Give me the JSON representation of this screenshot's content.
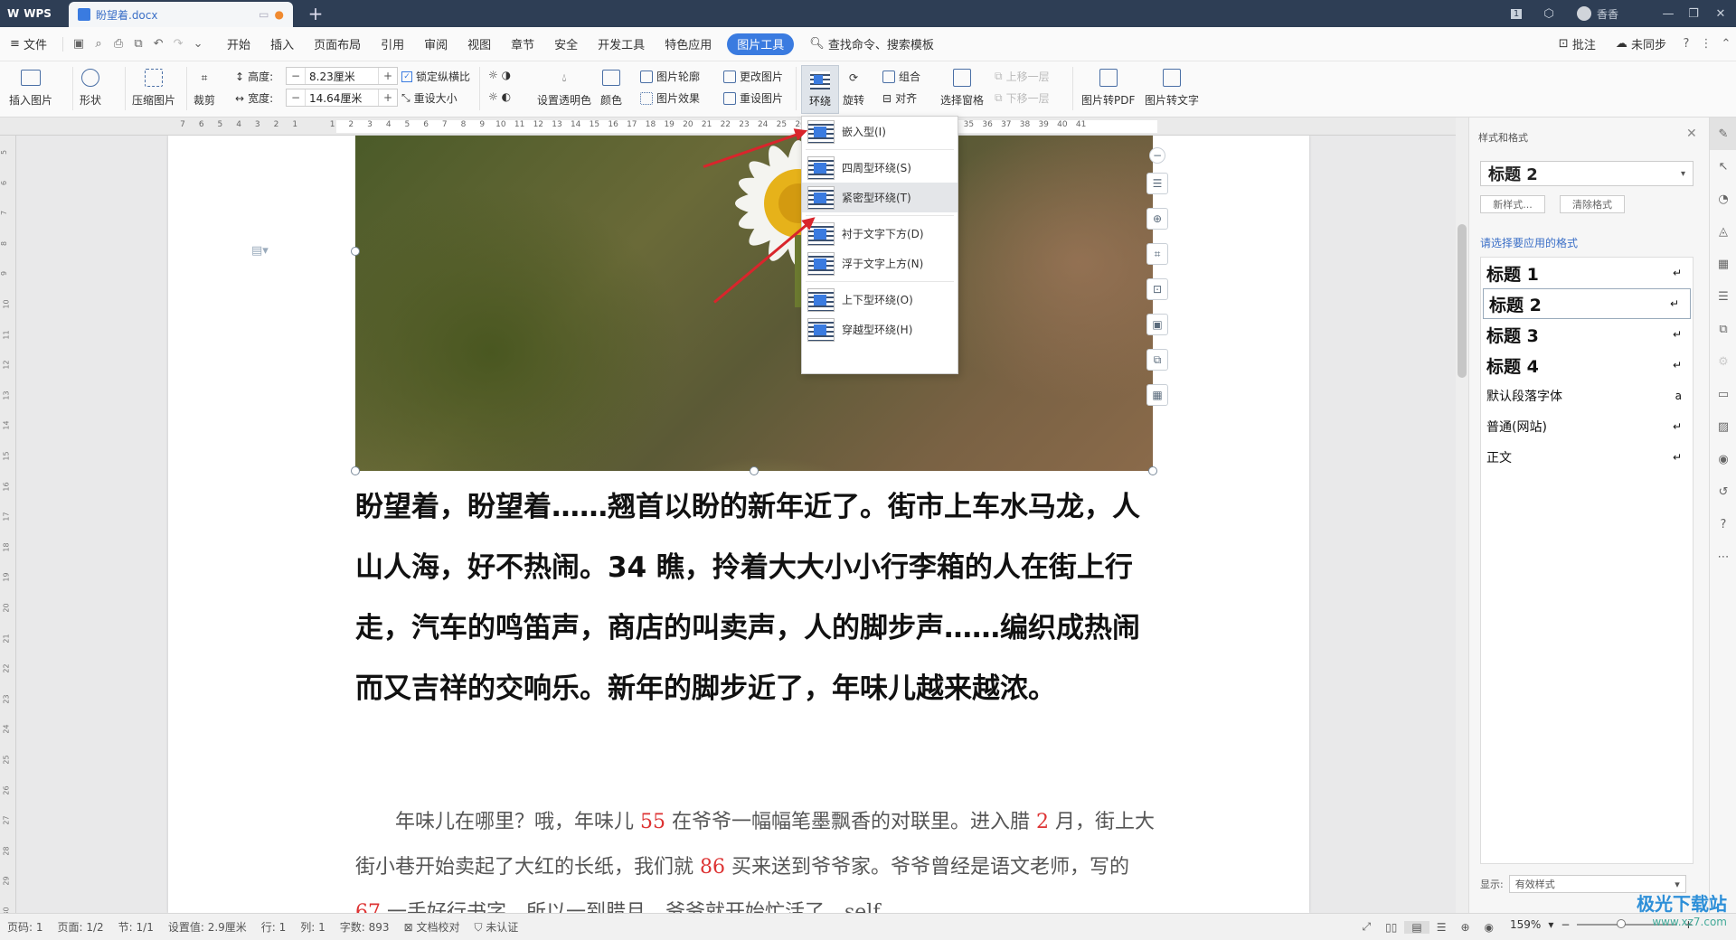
{
  "titlebar": {
    "app": "WPS",
    "doc_tab": "盼望着.docx",
    "page_badge": "1",
    "user": "香香"
  },
  "menu": {
    "file": "文件",
    "items": [
      "开始",
      "插入",
      "页面布局",
      "引用",
      "审阅",
      "视图",
      "章节",
      "安全",
      "开发工具",
      "特色应用"
    ],
    "active": "图片工具",
    "search": "查找命令、搜索模板",
    "comment": "批注",
    "sync": "未同步",
    "help": "?"
  },
  "ribbon": {
    "insert_pic": "插入图片",
    "shape": "形状",
    "compress": "压缩图片",
    "crop": "裁剪",
    "height_label": "高度:",
    "height_value": "8.23厘米",
    "width_label": "宽度:",
    "width_value": "14.64厘米",
    "lock_ratio": "锁定纵横比",
    "reset_size": "重设大小",
    "transparent": "设置透明色",
    "color": "颜色",
    "outline": "图片轮廓",
    "effect": "图片效果",
    "change_pic": "更改图片",
    "reset_pic": "重设图片",
    "wrap": "环绕",
    "rotate": "旋转",
    "group": "组合",
    "align": "对齐",
    "selection_pane": "选择窗格",
    "bring_forward": "上移一层",
    "send_backward": "下移一层",
    "to_pdf": "图片转PDF",
    "to_text": "图片转文字"
  },
  "ruler_numbers": [
    "7",
    "6",
    "5",
    "4",
    "3",
    "2",
    "1",
    "",
    "1",
    "2",
    "3",
    "4",
    "5",
    "6",
    "7",
    "8",
    "9",
    "10",
    "11",
    "12",
    "13",
    "14",
    "15",
    "16",
    "17",
    "18",
    "19",
    "20",
    "21",
    "22",
    "23",
    "24",
    "25",
    "26",
    "27",
    "28",
    "29",
    "30",
    "31",
    "32",
    "33",
    "34",
    "35",
    "36",
    "37",
    "38",
    "39",
    "40",
    "41"
  ],
  "vruler_numbers": [
    "5",
    "6",
    "7",
    "8",
    "9",
    "10",
    "11",
    "12",
    "13",
    "14",
    "15",
    "16",
    "17",
    "18",
    "19",
    "20",
    "21",
    "22",
    "23",
    "24",
    "25",
    "26",
    "27",
    "28",
    "29",
    "30"
  ],
  "wrap_menu": [
    {
      "label": "嵌入型(I)",
      "highlight": false
    },
    {
      "label": "四周型环绕(S)",
      "highlight": false
    },
    {
      "label": "紧密型环绕(T)",
      "highlight": true
    },
    {
      "label": "衬于文字下方(D)",
      "highlight": false
    },
    {
      "label": "浮于文字上方(N)",
      "highlight": false
    },
    {
      "label": "上下型环绕(O)",
      "highlight": false
    },
    {
      "label": "穿越型环绕(H)",
      "highlight": false
    }
  ],
  "document": {
    "bold_para": "盼望着，盼望着……翘首以盼的新年近了。街市上车水马龙，人山人海，好不热闹。34 瞧，拎着大大小小行李箱的人在街上行走，汽车的鸣笛声，商店的叫卖声，人的脚步声……编织成热闹而又吉祥的交响乐。新年的脚步近了，年味儿越来越浓。",
    "body_parts": [
      {
        "t": "年味儿在哪里？哦，年味儿 ",
        "red": false
      },
      {
        "t": "55",
        "red": true
      },
      {
        "t": " 在爷爷一幅幅笔墨飘香的对联里。进入腊 ",
        "red": false
      },
      {
        "t": "2",
        "red": true
      },
      {
        "t": " 月，街上大街小巷开始卖起了大红的长纸，我们就 ",
        "red": false
      },
      {
        "t": "86",
        "red": true
      },
      {
        "t": " 买来送到爷爷家。爷爷曾经是语文老师，写的 ",
        "red": false
      },
      {
        "t": "67",
        "red": true
      },
      {
        "t": " 一手好行书字，所以一到腊月，爷爷就开始忙活了，self",
        "red": false
      }
    ]
  },
  "panel": {
    "title": "样式和格式",
    "selected_style": "标题 2",
    "new_style": "新样式...",
    "clear_format": "清除格式",
    "apply_label": "请选择要应用的格式",
    "styles": [
      {
        "name": "标题 1",
        "mark": "↵",
        "big": true,
        "sel": false
      },
      {
        "name": "标题 2",
        "mark": "↵",
        "big": true,
        "sel": true
      },
      {
        "name": "标题 3",
        "mark": "↵",
        "big": true,
        "sel": false
      },
      {
        "name": "标题 4",
        "mark": "↵",
        "big": true,
        "sel": false
      },
      {
        "name": "默认段落字体",
        "mark": "a",
        "big": false,
        "sel": false
      },
      {
        "name": "普通(网站)",
        "mark": "↵",
        "big": false,
        "sel": false
      },
      {
        "name": "正文",
        "mark": "↵",
        "big": false,
        "sel": false
      }
    ],
    "show_label": "显示:",
    "show_value": "有效样式"
  },
  "status": {
    "page_no": "页码: 1",
    "pages": "页面: 1/2",
    "section": "节: 1/1",
    "setting": "设置值: 2.9厘米",
    "row": "行: 1",
    "col": "列: 1",
    "words": "字数: 893",
    "proof": "文档校对",
    "cert": "未认证",
    "zoom": "159%"
  },
  "watermark": {
    "brand": "极光下载站",
    "url": "www.xz7.com"
  },
  "colors": {
    "accent": "#3a7be0",
    "titlebar": "#2e3e55",
    "arrow": "#d9252c"
  }
}
